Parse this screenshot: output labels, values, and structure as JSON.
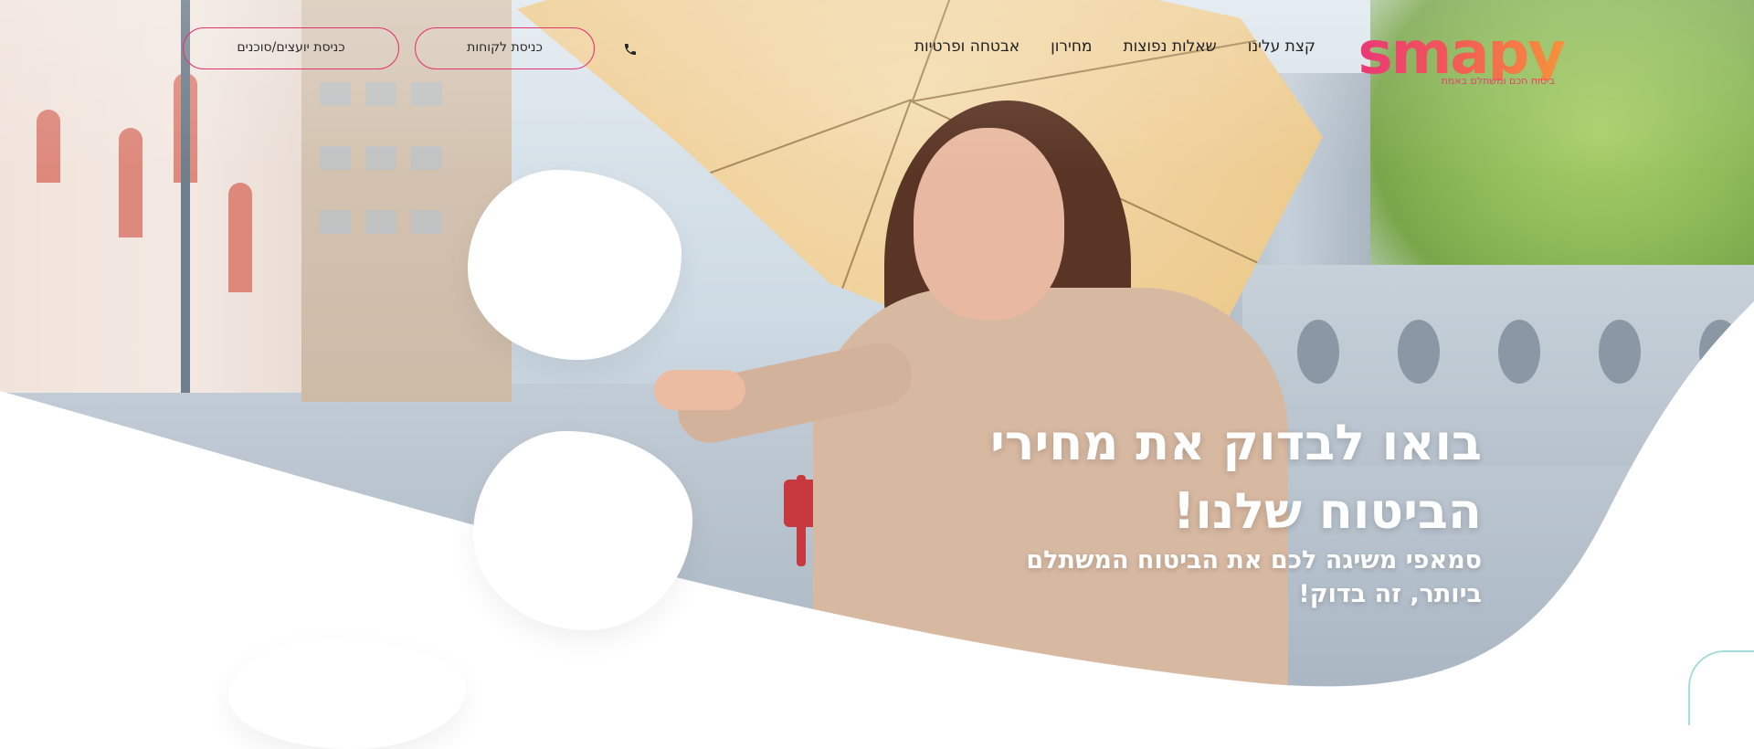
{
  "brand": {
    "logo_text": "smapy",
    "tagline": "ביטוח חכם ומשתלם באמת",
    "colors": {
      "pink": "#e8337a",
      "orange": "#f6923a",
      "outline": "#e1346f"
    }
  },
  "nav": {
    "items": [
      {
        "label": "קצת עלינו"
      },
      {
        "label": "שאלות נפוצות"
      },
      {
        "label": "מחירון"
      },
      {
        "label": "אבטחה ופרטיות"
      }
    ]
  },
  "header_actions": {
    "phone_icon": "phone-icon",
    "customer_login": "כניסת לקוחות",
    "agents_login": "כניסת יועצים/סוכנים"
  },
  "hero": {
    "headline": "בואו לבדוק את מחירי הביטוח שלנו!",
    "subline": "סמאפי משיגה לכם את הביטוח המשתלם ביותר, זה בדוק!"
  }
}
